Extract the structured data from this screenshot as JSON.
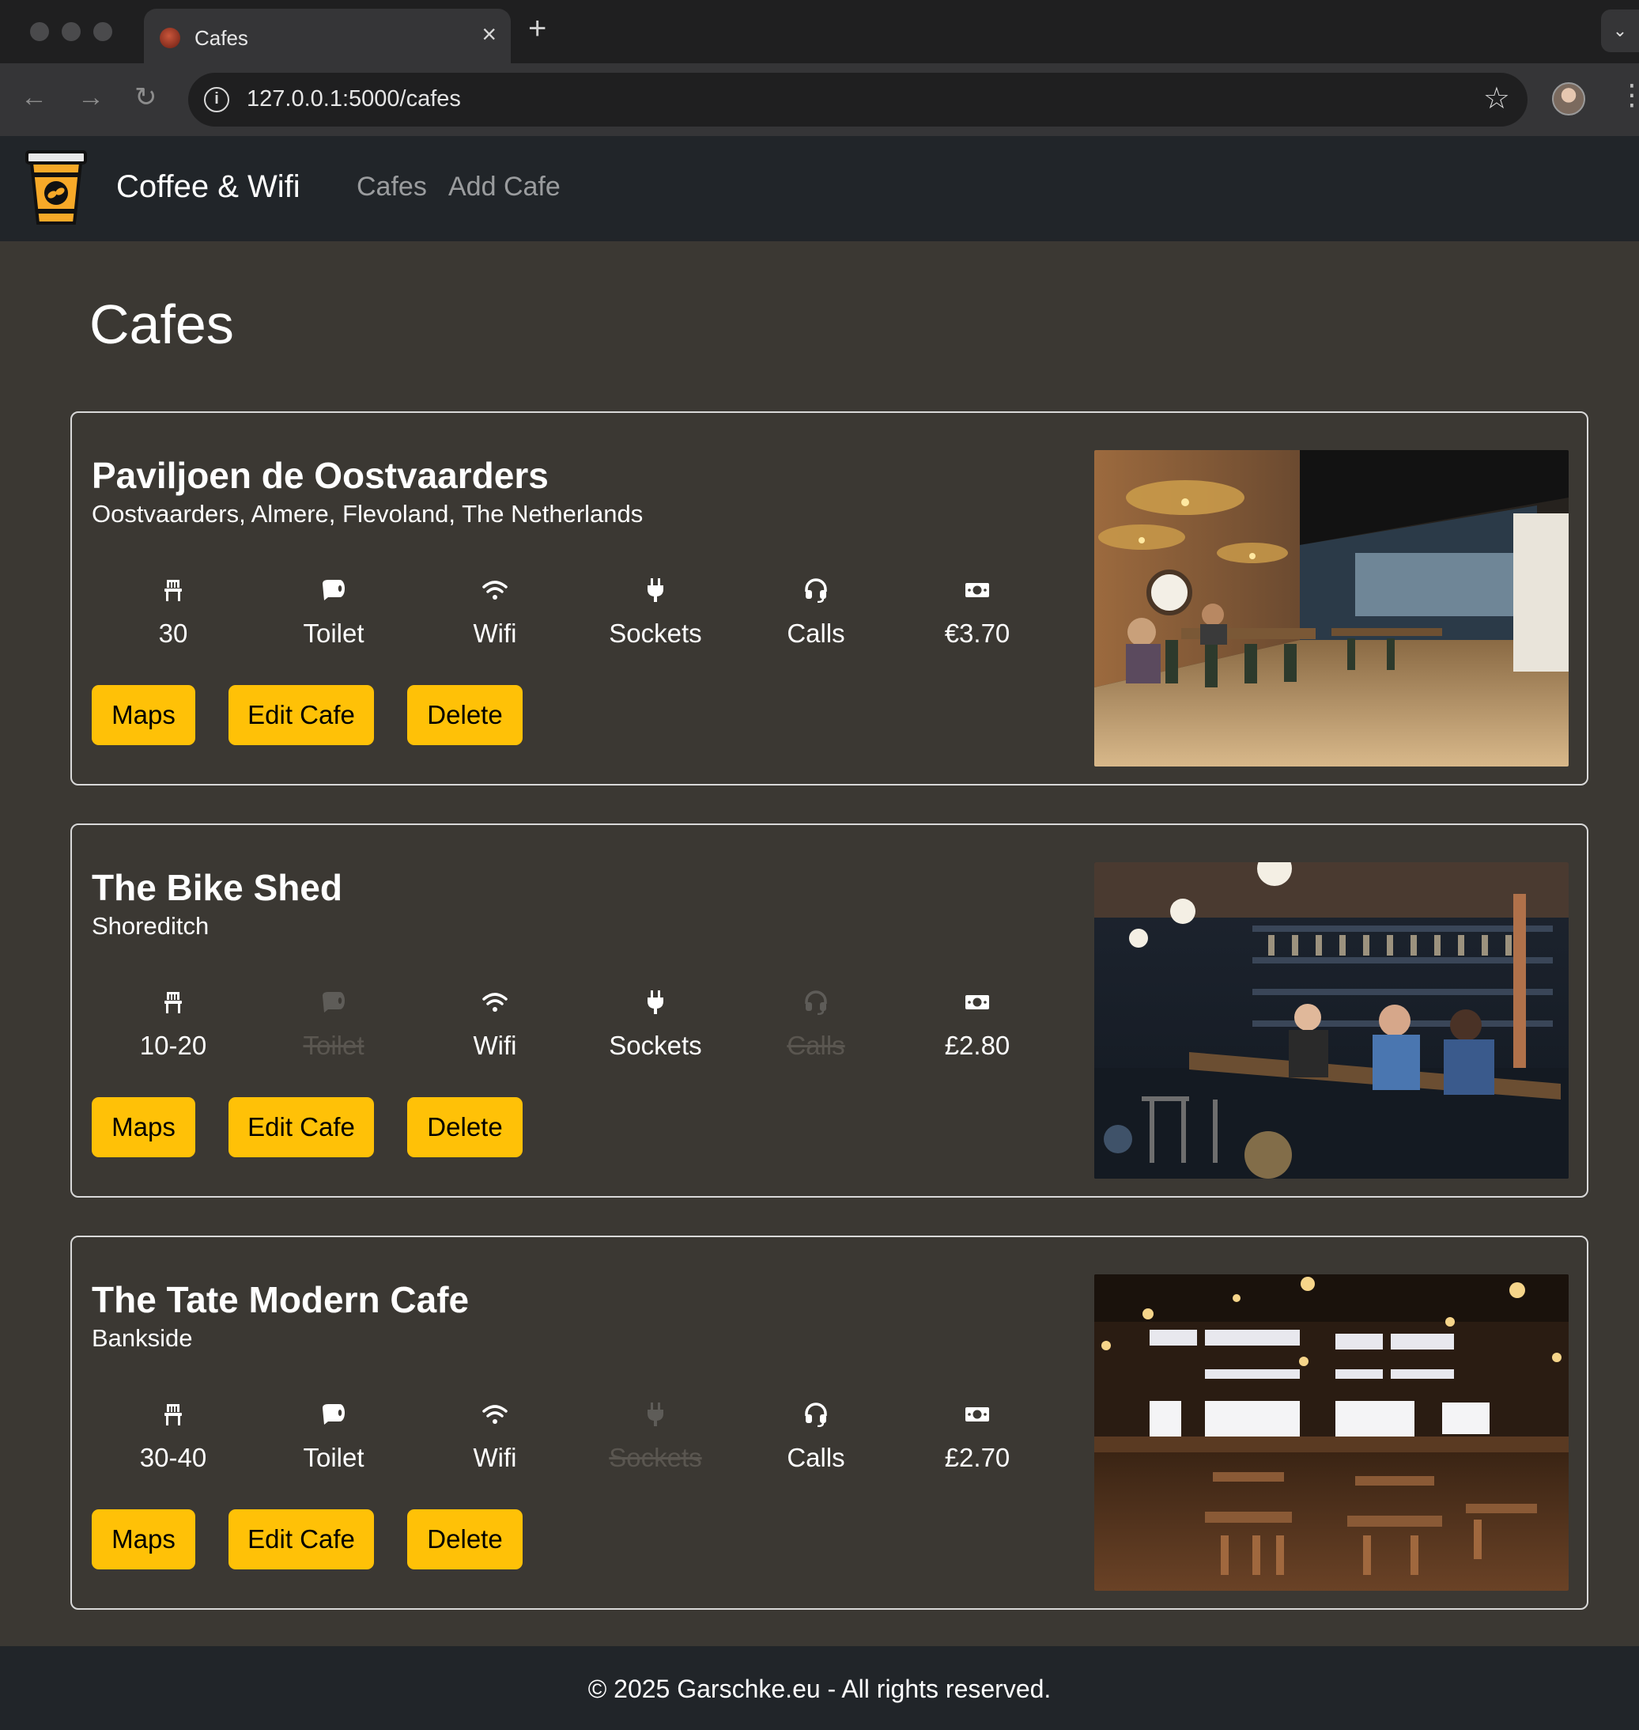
{
  "browser": {
    "tab_title": "Cafes",
    "tab_close": "×",
    "new_tab": "+",
    "tab_menu": "⌄",
    "back": "←",
    "forward": "→",
    "reload": "↻",
    "info": "i",
    "url": "127.0.0.1:5000/cafes",
    "bookmark": "☆",
    "menu": "⋮"
  },
  "navbar": {
    "brand": "Coffee & Wifi",
    "links": [
      "Cafes",
      "Add Cafe"
    ]
  },
  "page": {
    "title": "Cafes"
  },
  "cafes": [
    {
      "name": "Paviljoen de Oostvaarders",
      "location": "Oostvaarders, Almere, Flevoland, The Netherlands",
      "seats": "30",
      "toilet": "Toilet",
      "wifi": "Wifi",
      "sockets": "Sockets",
      "calls": "Calls",
      "price": "€3.70",
      "has_toilet": true,
      "has_wifi": true,
      "has_sockets": true,
      "can_take_calls": true,
      "buttons": {
        "maps": "Maps",
        "edit": "Edit Cafe",
        "delete": "Delete"
      }
    },
    {
      "name": "The Bike Shed",
      "location": "Shoreditch",
      "seats": "10-20",
      "toilet": "Toilet",
      "wifi": "Wifi",
      "sockets": "Sockets",
      "calls": "Calls",
      "price": "£2.80",
      "has_toilet": false,
      "has_wifi": true,
      "has_sockets": true,
      "can_take_calls": false,
      "buttons": {
        "maps": "Maps",
        "edit": "Edit Cafe",
        "delete": "Delete"
      }
    },
    {
      "name": "The Tate Modern Cafe",
      "location": "Bankside",
      "seats": "30-40",
      "toilet": "Toilet",
      "wifi": "Wifi",
      "sockets": "Sockets",
      "calls": "Calls",
      "price": "£2.70",
      "has_toilet": true,
      "has_wifi": true,
      "has_sockets": false,
      "can_take_calls": true,
      "buttons": {
        "maps": "Maps",
        "edit": "Edit Cafe",
        "delete": "Delete"
      }
    }
  ],
  "footer": {
    "text": "© 2025 Garschke.eu - All rights reserved."
  },
  "colors": {
    "accent": "#ffc107",
    "page_bg": "#3b3833",
    "navbar_bg": "#212529"
  }
}
